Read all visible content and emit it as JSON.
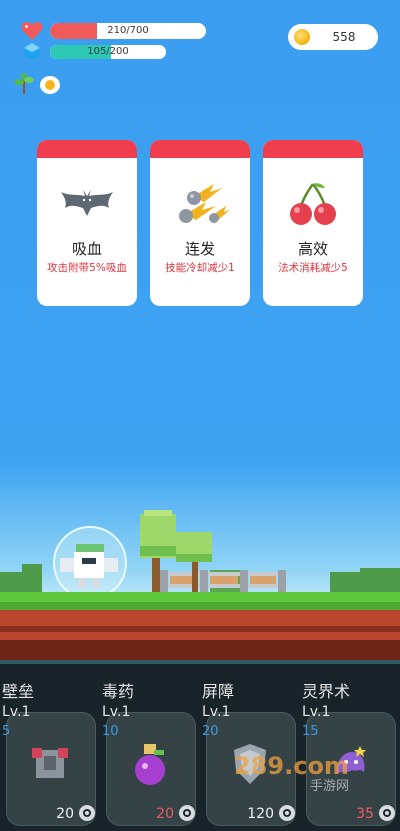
{
  "hud": {
    "health": {
      "text": "210/700",
      "fraction": 0.3,
      "color": "#f05a5a"
    },
    "mana": {
      "text": "105/200",
      "fraction": 0.525,
      "color": "#2ec9b5"
    },
    "coins": "558",
    "health_icon": "heart-icon",
    "mana_icon": "crystal-icon",
    "extra_icons": [
      "plant-icon",
      "egg-icon"
    ]
  },
  "cards": [
    {
      "name": "吸血",
      "desc": "攻击附带5%吸血",
      "icon": "bat-icon"
    },
    {
      "name": "连发",
      "desc": "技能冷却减少1",
      "icon": "meteor-icon"
    },
    {
      "name": "高效",
      "desc": "法术消耗减少5",
      "icon": "cherry-icon"
    }
  ],
  "skills": [
    {
      "name": "壁垒",
      "level": "Lv.1",
      "cost": "5",
      "price": "20",
      "icon": "armor-icon",
      "price_color": "#f0f0f0"
    },
    {
      "name": "毒药",
      "level": "Lv.1",
      "cost": "10",
      "price": "20",
      "icon": "potion-icon",
      "price_color": "#ef5a6a"
    },
    {
      "name": "屏障",
      "level": "Lv.1",
      "cost": "20",
      "price": "120",
      "icon": "shield-icon",
      "price_color": "#f0f0f0"
    },
    {
      "name": "灵界术",
      "level": "Lv.1",
      "cost": "15",
      "price": "35",
      "icon": "spirit-icon",
      "price_color": "#ef5a6a"
    }
  ],
  "watermark": {
    "text": "289.com",
    "subtext": "手游网"
  }
}
